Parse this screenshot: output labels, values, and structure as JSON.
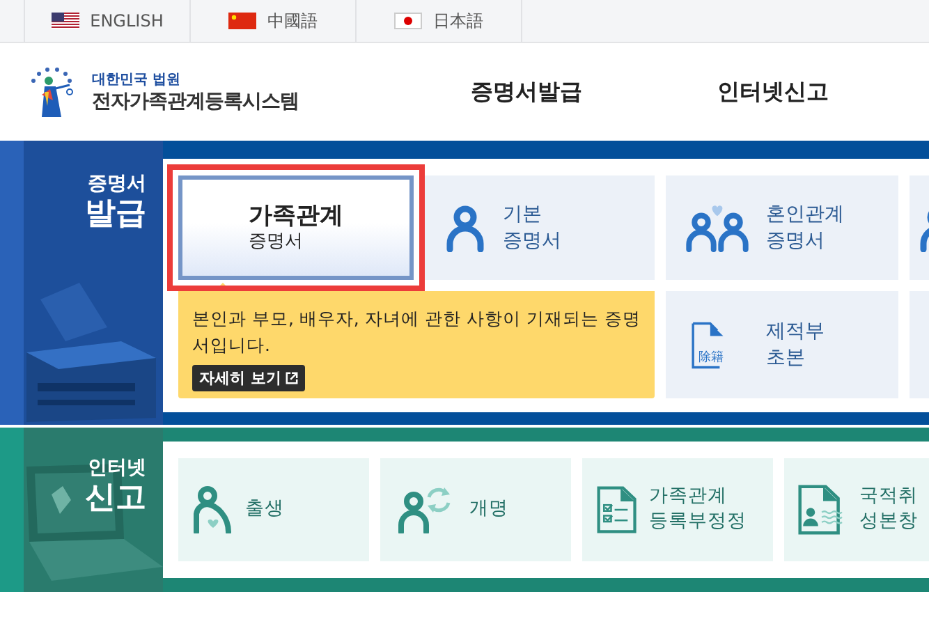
{
  "languages": [
    {
      "label": "ENGLISH",
      "kind": "us"
    },
    {
      "label": "中國語",
      "kind": "cn"
    },
    {
      "label": "日本語",
      "kind": "jp"
    }
  ],
  "logo": {
    "org": "대한민국 법원",
    "system": "전자가족관계등록시스템"
  },
  "nav": [
    "증명서발급",
    "인터넷신고"
  ],
  "issue": {
    "heading_small": "증명서",
    "heading_large": "발급",
    "cards": [
      {
        "lines": [
          "가족관계",
          "증명서"
        ],
        "kind": "plain",
        "selected": true
      },
      {
        "lines": [
          "기본",
          "증명서"
        ],
        "kind": "person",
        "selected": false
      },
      {
        "lines": [
          "혼인관계",
          "증명서"
        ],
        "kind": "couple",
        "selected": false
      },
      {
        "kind": "person",
        "selected": false
      },
      {
        "lines": [
          "제적부",
          "초본"
        ],
        "kind": "removed",
        "glyphs": "除籍",
        "selected": false
      },
      {
        "kind": "plain",
        "selected": false
      }
    ],
    "description": {
      "text": "본인과 부모, 배우자, 자녀에 관한 사항이 기재되는 증명서입니다.",
      "link": "자세히 보기"
    }
  },
  "report": {
    "heading_small": "인터넷",
    "heading_large": "신고",
    "cards": [
      {
        "lines": [
          "출생"
        ],
        "kind": "birth"
      },
      {
        "lines": [
          "개명"
        ],
        "kind": "rename"
      },
      {
        "lines": [
          "가족관계",
          "등록부정정"
        ],
        "kind": "checklist"
      },
      {
        "lines": [
          "국적취",
          "성본창"
        ],
        "kind": "identity"
      }
    ]
  }
}
